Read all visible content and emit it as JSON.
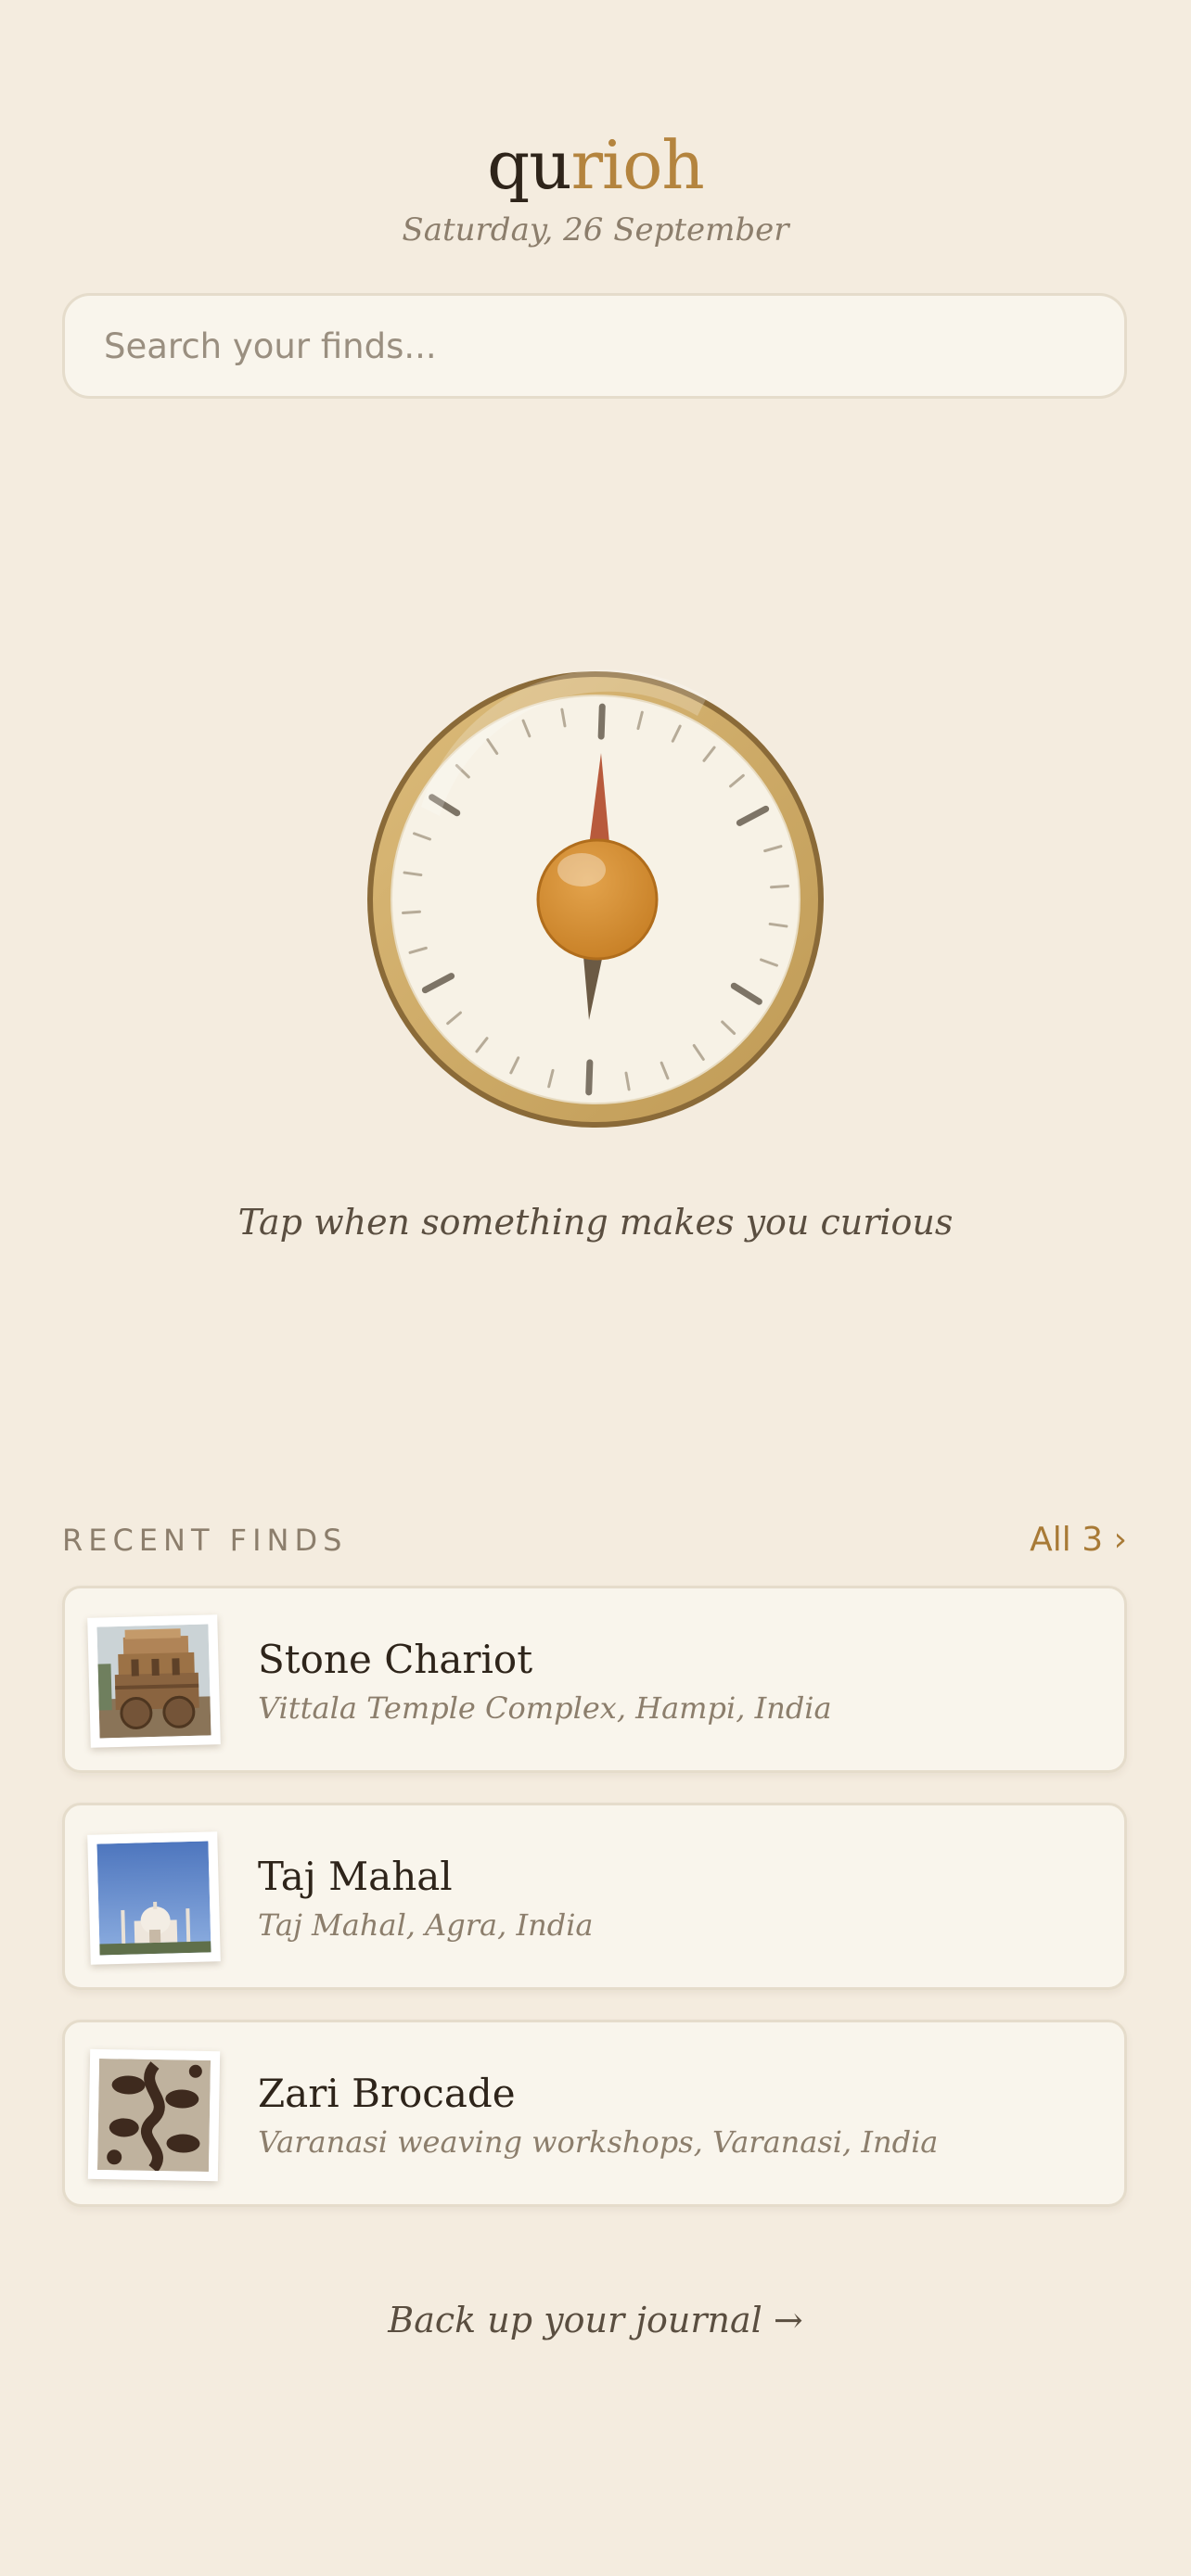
{
  "app": {
    "logo_prefix": "qu",
    "logo_accent": "rioh",
    "date": "Saturday, 26 September",
    "colors": {
      "background": "#f4ecdf",
      "accent": "#b4843e",
      "text": "#2e241a",
      "muted": "#8c7e6c"
    }
  },
  "search": {
    "placeholder": "Search your finds...",
    "value": ""
  },
  "compass": {
    "icon": "compass-icon",
    "prompt": "Tap when something makes you curious"
  },
  "recent": {
    "title": "RECENT FINDS",
    "all_link": "All 3 ›",
    "items": [
      {
        "title": "Stone Chariot",
        "location": "Vittala Temple Complex, Hampi, India",
        "thumb": "stone-chariot-thumbnail"
      },
      {
        "title": "Taj Mahal",
        "location": "Taj Mahal, Agra, India",
        "thumb": "taj-mahal-thumbnail"
      },
      {
        "title": "Zari Brocade",
        "location": "Varanasi weaving workshops, Varanasi, India",
        "thumb": "zari-brocade-thumbnail"
      }
    ]
  },
  "footer": {
    "backup_link": "Back up your journal →"
  }
}
